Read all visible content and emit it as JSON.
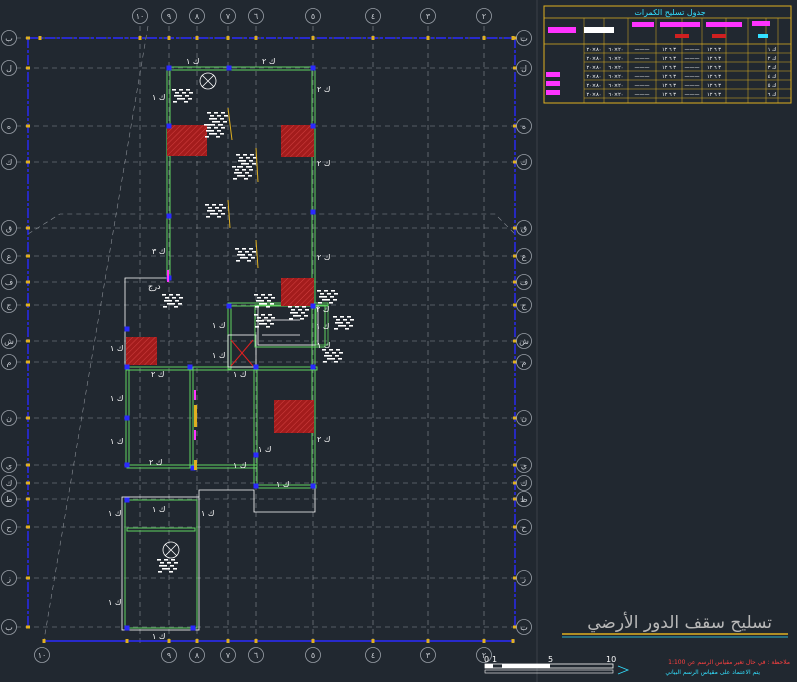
{
  "drawing": {
    "title": "تسليح سقف الدور الأرضي",
    "colors": {
      "background": "#212830",
      "grid": "#8a8f96",
      "beam": "#5fd35f",
      "slab_edge": "#ffffff",
      "dim_line": "#2a2aff",
      "dim_tick": "#e0b020",
      "column": "#a31c1c",
      "magenta": "#ff33ff",
      "cyan": "#33e0ff"
    },
    "column_bubbles_top": [
      "١٠",
      "٩",
      "٨",
      "٧",
      "٦",
      "٥",
      "٤",
      "٣",
      "٢",
      "١"
    ],
    "column_bubbles_bottom": [
      "١٠",
      "٩",
      "٨",
      "٧",
      "٦",
      "٥",
      "٤",
      "٣",
      "٢",
      "١"
    ],
    "row_bubbles_left": [
      "ب",
      "ل",
      "ه",
      "ك",
      "ق",
      "ع",
      "ف",
      "ج",
      "ش",
      "م",
      "ن",
      "ي",
      "ك",
      "ط",
      "ح",
      "ز",
      "ب",
      "أ"
    ],
    "row_bubbles_right": [
      "ب",
      "ل",
      "ه",
      "ك",
      "ق",
      "ع",
      "ف",
      "ج",
      "ش",
      "م",
      "ن",
      "ي",
      "ك",
      "ط",
      "ح",
      "ز",
      "ب",
      "أ"
    ],
    "beam_labels": {
      "b1": "ك ١",
      "b2": "ك ٢",
      "b3": "ك ١",
      "b4": "ك ٢",
      "b5": "ك ٢",
      "b6": "ك ٣",
      "b7": "ك ٢",
      "b8": "ك ١",
      "b9": "ك ١",
      "b10": "ك ٢",
      "b11": "ك ١",
      "b12": "ك ١",
      "b13": "ك ١",
      "b14": "ك ١",
      "b15": "ك ٢",
      "b16": "ك ١",
      "b17": "ك ١",
      "b18": "ك ١",
      "b19": "ك ١",
      "b20": "ك ١",
      "b21": "ك ١",
      "b22": "ك ١",
      "b23": "ك ٢",
      "b24": "ك ١",
      "b25": "ك ٢",
      "b26": "ك ١",
      "b27": "ك ١"
    },
    "room_label": "درج",
    "table": {
      "title": "جدول تسليح الكمرات",
      "rows": [
        [
          "٨٠×٢٠",
          "٢٠×٦٠",
          "———",
          "٣ ٦ ١٢",
          "———",
          "٣ ٦ ١٢",
          "ك ١"
        ],
        [
          "٨٠×٢٠",
          "٢٠×٦٠",
          "———",
          "٣ ٦ ١٢",
          "———",
          "٣ ٦ ١٢",
          "ك ٢"
        ],
        [
          "٨٠×٢٠",
          "٢٠×٦٠",
          "———",
          "٣ ٦ ١٢",
          "———",
          "٣ ٦ ١٢",
          "ك ٣"
        ],
        [
          "٨٠×٢٠",
          "٢٠×٦٠",
          "———",
          "٣ ٦ ١٢",
          "———",
          "٣ ٦ ١٢",
          "ك ٤"
        ],
        [
          "٨٠×٢٠",
          "٢٠×٦٠",
          "———",
          "٣ ٦ ١٢",
          "———",
          "٣ ٦ ١٢",
          "ك ٥"
        ],
        [
          "٨٠×٢٠",
          "٢٠×٦٠",
          "———",
          "٣ ٦ ١٢",
          "———",
          "٣ ٦ ١٢",
          "ك ٦"
        ]
      ]
    },
    "scale": {
      "ticks": [
        "0",
        "1",
        "5",
        "10"
      ]
    },
    "notes": [
      "ملاحظة : في حال تغير مقياس الرسم عن 1:100",
      "يتم الاعتماد على مقياس الرسم البياني"
    ]
  }
}
